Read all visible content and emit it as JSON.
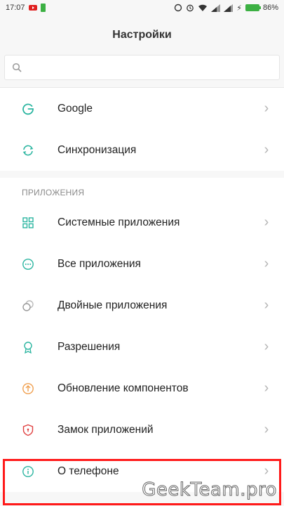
{
  "status_bar": {
    "time": "17:07",
    "battery": "86%"
  },
  "header": {
    "title": "Настройки"
  },
  "search": {
    "placeholder": ""
  },
  "accounts": [
    {
      "label": "Google",
      "icon": "google-icon"
    },
    {
      "label": "Синхронизация",
      "icon": "sync-icon"
    }
  ],
  "apps_section": {
    "title": "ПРИЛОЖЕНИЯ",
    "items": [
      {
        "label": "Системные приложения",
        "icon": "grid-icon"
      },
      {
        "label": "Все приложения",
        "icon": "dots-circle-icon"
      },
      {
        "label": "Двойные приложения",
        "icon": "dual-circles-icon"
      },
      {
        "label": "Разрешения",
        "icon": "badge-icon"
      },
      {
        "label": "Обновление компонентов",
        "icon": "update-icon"
      },
      {
        "label": "Замок приложений",
        "icon": "shield-icon"
      },
      {
        "label": "О телефоне",
        "icon": "info-icon"
      }
    ]
  },
  "watermark": "GeekTeam.pro",
  "colors": {
    "accent": "#2bb5a0",
    "highlight": "#ff1a1a",
    "update": "#f0a050",
    "shield": "#e04040"
  }
}
